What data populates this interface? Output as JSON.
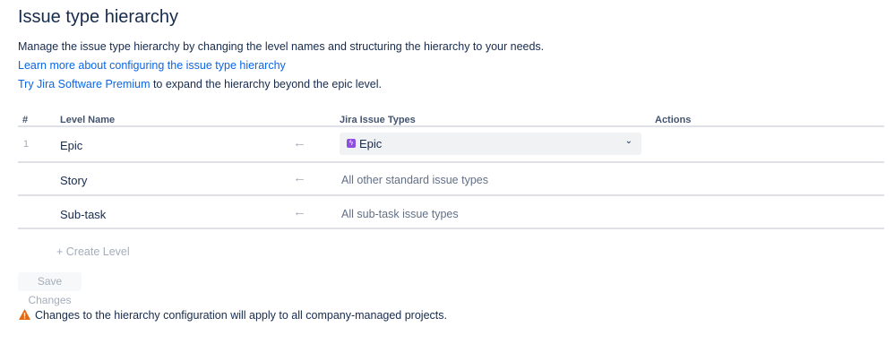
{
  "title": "Issue type hierarchy",
  "description": "Manage the issue type hierarchy by changing the level names and structuring the hierarchy to your needs.",
  "learn_more_link": "Learn more about configuring the issue type hierarchy",
  "premium_link": "Try Jira Software Premium",
  "premium_suffix": " to expand the hierarchy beyond the epic level.",
  "table": {
    "headers": {
      "num": "#",
      "level_name": "Level Name",
      "issue_types": "Jira Issue Types",
      "actions": "Actions"
    },
    "rows": [
      {
        "num": "1",
        "name": "Epic",
        "issue_type": "Epic"
      },
      {
        "num": "",
        "name": "Story",
        "issue_type": "All other standard issue types"
      },
      {
        "num": "",
        "name": "Sub-task",
        "issue_type": "All sub-task issue types"
      }
    ]
  },
  "create_level": "Create Level",
  "save_button": "Save Changes",
  "warning": "Changes to the hierarchy configuration will apply to all company-managed projects.",
  "colors": {
    "link": "#0c66e4",
    "epic": "#904ee2",
    "warning": "#e56910"
  }
}
